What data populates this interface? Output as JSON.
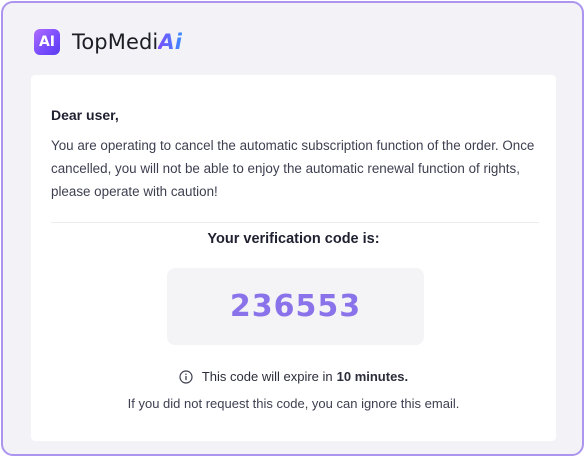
{
  "brand": {
    "logo_text": "AI",
    "name_main": "TopMedi",
    "name_accent": "Ai"
  },
  "email": {
    "greeting": "Dear user,",
    "message": "You are operating to cancel the automatic subscription function of the order. Once cancelled, you will not be able to enjoy the automatic renewal function of rights, please operate with caution!",
    "code_heading": "Your verification code is:",
    "code": "236553",
    "expire_prefix": "This code will expire in",
    "expire_duration": "10 minutes.",
    "ignore_note": "If you did not request this code, you can ignore this email."
  },
  "icons": {
    "info": "info-circle-icon",
    "logo": "topmediai-logo-icon"
  },
  "colors": {
    "border": "#ab95ee",
    "code": "#8a72ea",
    "background": "#f3f3f7"
  }
}
